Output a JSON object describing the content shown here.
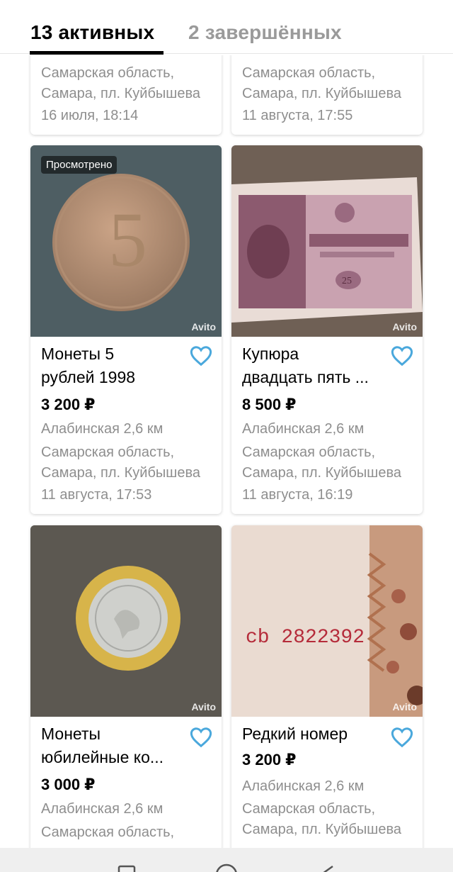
{
  "tabs": {
    "active_label": "13 активных",
    "inactive_label": "2 завершённых"
  },
  "top_row": [
    {
      "region": "Самарская область,",
      "address": "Самара, пл. Куйбышева",
      "date": "16 июля, 18:14"
    },
    {
      "region": "Самарская область,",
      "address": "Самара, пл. Куйбышева",
      "date": "11 августа, 17:55"
    }
  ],
  "listings": [
    {
      "title_line1": "Монеты 5",
      "title_line2": "рублей 1998",
      "price": "3 200 ₽",
      "metro": "Алабинская 2,6 км",
      "region": "Самарская область,",
      "address": "Самара, пл. Куйбышева",
      "date": "11 августа, 17:53",
      "badge": "Просмотрено",
      "watermark": "Avito",
      "coin_digit": "5"
    },
    {
      "title_line1": "Купюра",
      "title_line2": "двадцать пять ...",
      "price": "8 500 ₽",
      "metro": "Алабинская 2,6 км",
      "region": "Самарская область,",
      "address": "Самара, пл. Куйбышева",
      "date": "11 августа, 16:19",
      "watermark": "Avito"
    },
    {
      "title_line1": "Монеты",
      "title_line2": "юбилейные ко...",
      "price": "3 000 ₽",
      "metro": "Алабинская 2,6 км",
      "region": "Самарская область,",
      "watermark": "Avito"
    },
    {
      "title_line1": "Редкий номер",
      "price": "3 200 ₽",
      "metro": "Алабинская 2,6 км",
      "region": "Самарская область,",
      "address": "Самара, пл. Куйбышева",
      "watermark": "Avito",
      "serial": "cb 2822392"
    }
  ],
  "colors": {
    "accent": "#4aa8dc",
    "muted_text": "#8e8e8e"
  },
  "icons": {
    "favorite": "heart-outline-icon",
    "nav": [
      "recent-apps-icon",
      "home-icon",
      "back-icon"
    ]
  }
}
